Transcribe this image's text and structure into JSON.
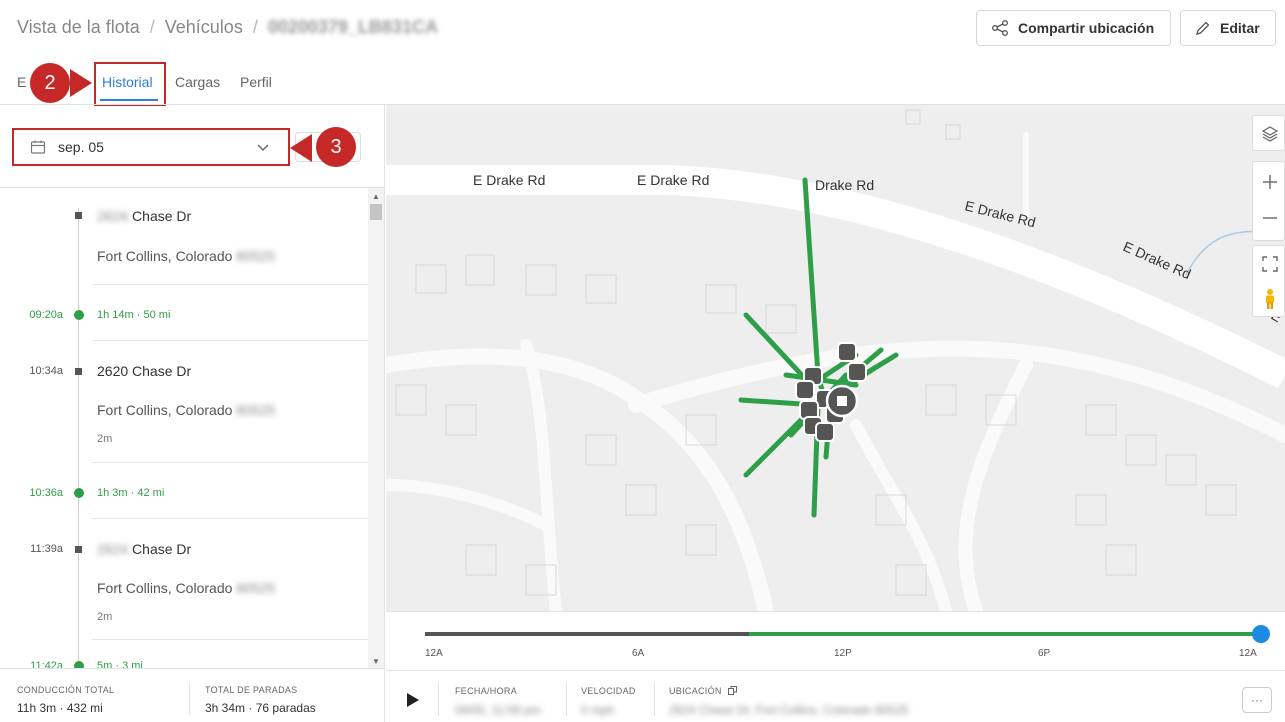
{
  "breadcrumb": {
    "root": "Vista de la flota",
    "section": "Vehículos",
    "vehicle": "00200379_LB831CA"
  },
  "header": {
    "share_label": "Compartir ubicación",
    "edit_label": "Editar"
  },
  "tabs": {
    "first_partial": "E",
    "items": [
      "Historial",
      "Cargas",
      "Perfil"
    ],
    "active": "Historial"
  },
  "callouts": {
    "tabs": "2",
    "date": "3"
  },
  "date_picker": {
    "value": "sep. 05"
  },
  "timeline": {
    "stop1": {
      "addr_num": "2624",
      "addr_street": " Chase Dr",
      "city": "Fort Collins, Colorado",
      "zip": "80525"
    },
    "drive1": {
      "time": "09:20a",
      "duration": "1h 14m",
      "distance": "50 mi"
    },
    "stop2": {
      "time": "10:34a",
      "address": "2620 Chase Dr",
      "city": "Fort Collins, Colorado",
      "zip": "80525",
      "duration": "2m"
    },
    "drive2": {
      "time": "10:36a",
      "duration": "1h 3m",
      "distance": "42 mi"
    },
    "stop3": {
      "time": "11:39a",
      "addr_num": "2624",
      "addr_street": " Chase Dr",
      "city": "Fort Collins, Colorado",
      "zip": "80525",
      "duration": "2m"
    },
    "drive3": {
      "time": "11:42a",
      "duration": "5m",
      "distance": "3 mi"
    },
    "separator": "·"
  },
  "totals": {
    "driving_label": "CONDUCCIÓN TOTAL",
    "driving_time": "11h 3m",
    "driving_dist": "432 mi",
    "stops_label": "TOTAL DE PARADAS",
    "stops_time": "3h 34m",
    "stops_count": "76 paradas"
  },
  "map": {
    "roads": [
      "E Drake Rd",
      "E Drake Rd",
      "Drake Rd",
      "E Drake Rd",
      "E Drake Rd",
      "E"
    ],
    "route_color": "#2e9e48"
  },
  "playback": {
    "ticks": [
      "12A",
      "6A",
      "12P",
      "6P",
      "12A"
    ],
    "progress": 1.0,
    "date_label": "FECHA/HORA",
    "date_value": "09/05, 11:59 pm",
    "speed_label": "VELOCIDAD",
    "speed_value": "0 mph",
    "location_label": "UBICACIÓN",
    "location_value": "2624 Chase Dr, Fort Collins, Colorado 80525",
    "more": "···"
  }
}
